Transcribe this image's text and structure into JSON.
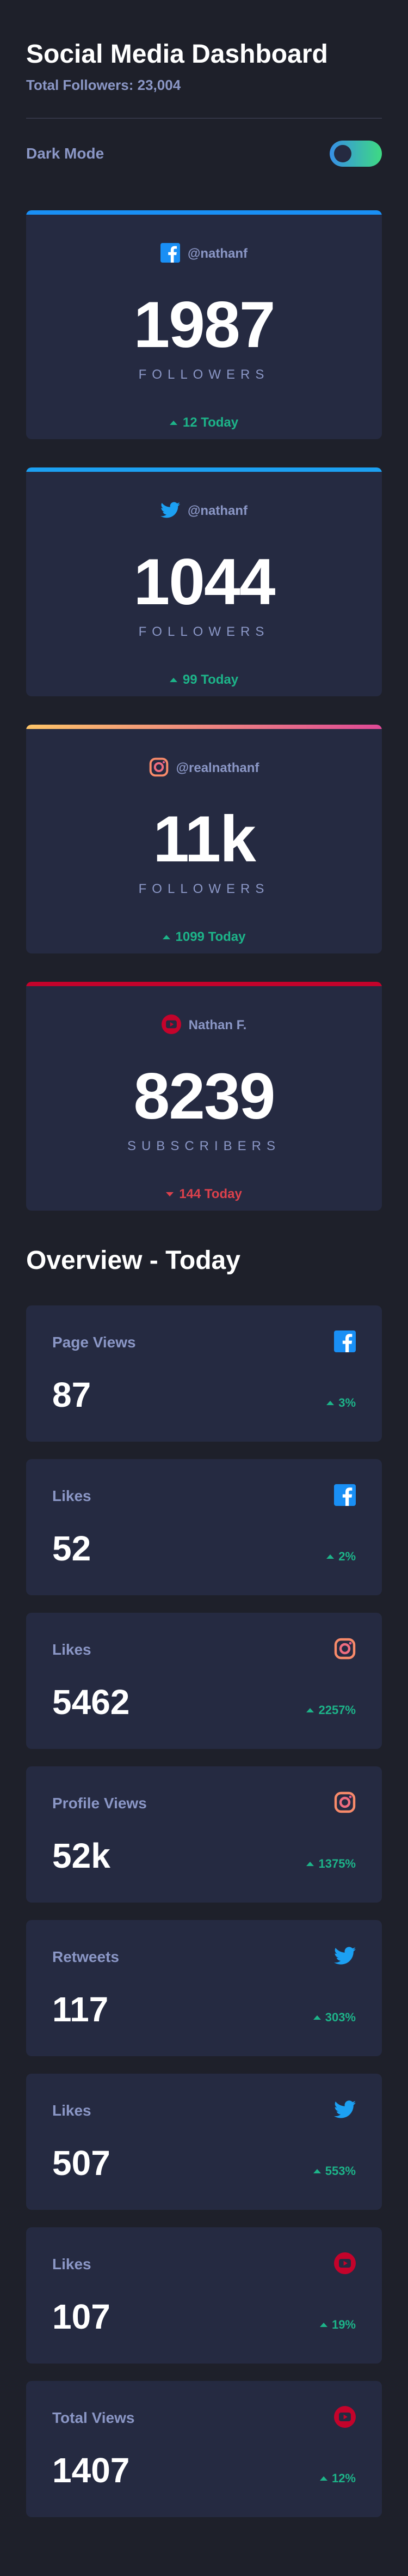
{
  "header": {
    "title": "Social Media Dashboard",
    "total_followers": "Total Followers: 23,004"
  },
  "dark_mode": {
    "label": "Dark Mode",
    "enabled": true
  },
  "colors": {
    "facebook": "#198ff5",
    "twitter": "#1ca0f2",
    "instagram_start": "#fdc468",
    "instagram_end": "#df4996",
    "youtube": "#c4032b",
    "up": "#1db489",
    "down": "#dc414c"
  },
  "follower_cards": [
    {
      "platform": "facebook",
      "icon": "facebook-icon",
      "handle": "@nathanf",
      "count": "1987",
      "unit": "FOLLOWERS",
      "delta": "12 Today",
      "direction": "up"
    },
    {
      "platform": "twitter",
      "icon": "twitter-icon",
      "handle": "@nathanf",
      "count": "1044",
      "unit": "FOLLOWERS",
      "delta": "99 Today",
      "direction": "up"
    },
    {
      "platform": "instagram",
      "icon": "instagram-icon",
      "handle": "@realnathanf",
      "count": "11k",
      "unit": "FOLLOWERS",
      "delta": "1099 Today",
      "direction": "up"
    },
    {
      "platform": "youtube",
      "icon": "youtube-icon",
      "handle": "Nathan F.",
      "count": "8239",
      "unit": "SUBSCRIBERS",
      "delta": "144 Today",
      "direction": "down"
    }
  ],
  "overview": {
    "title": "Overview - Today",
    "cards": [
      {
        "metric": "Page Views",
        "platform": "facebook",
        "icon": "facebook-icon",
        "value": "87",
        "pct": "3%",
        "direction": "up"
      },
      {
        "metric": "Likes",
        "platform": "facebook",
        "icon": "facebook-icon",
        "value": "52",
        "pct": "2%",
        "direction": "up"
      },
      {
        "metric": "Likes",
        "platform": "instagram",
        "icon": "instagram-icon",
        "value": "5462",
        "pct": "2257%",
        "direction": "up"
      },
      {
        "metric": "Profile Views",
        "platform": "instagram",
        "icon": "instagram-icon",
        "value": "52k",
        "pct": "1375%",
        "direction": "up"
      },
      {
        "metric": "Retweets",
        "platform": "twitter",
        "icon": "twitter-icon",
        "value": "117",
        "pct": "303%",
        "direction": "up"
      },
      {
        "metric": "Likes",
        "platform": "twitter",
        "icon": "twitter-icon",
        "value": "507",
        "pct": "553%",
        "direction": "up"
      },
      {
        "metric": "Likes",
        "platform": "youtube",
        "icon": "youtube-icon",
        "value": "107",
        "pct": "19%",
        "direction": "up"
      },
      {
        "metric": "Total Views",
        "platform": "youtube",
        "icon": "youtube-icon",
        "value": "1407",
        "pct": "12%",
        "direction": "up"
      }
    ]
  }
}
